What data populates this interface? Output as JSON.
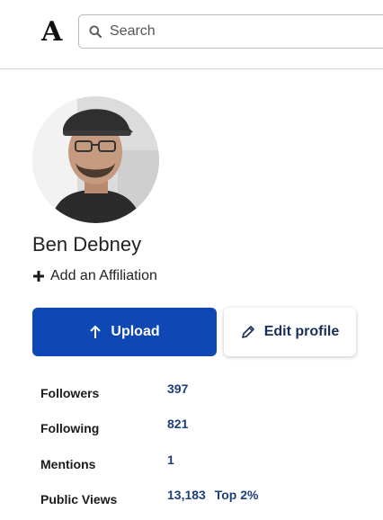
{
  "header": {
    "logo_text": "A",
    "search": {
      "placeholder": "Search",
      "value": ""
    }
  },
  "profile": {
    "name": "Ben Debney",
    "affiliation_link": "Add an Affiliation"
  },
  "actions": {
    "upload_label": "Upload",
    "edit_label": "Edit profile"
  },
  "stats": [
    {
      "label": "Followers",
      "value": "397",
      "extra": ""
    },
    {
      "label": "Following",
      "value": "821",
      "extra": ""
    },
    {
      "label": "Mentions",
      "value": "1",
      "extra": ""
    },
    {
      "label": "Public Views",
      "value": "13,183",
      "extra": "Top 2%"
    }
  ],
  "colors": {
    "primary": "#0f47b5",
    "stat_value": "#1e3f7a"
  },
  "icons": {
    "search": "search-icon",
    "plus": "plus-icon",
    "upload": "arrow-up-icon",
    "edit": "pencil-icon"
  }
}
